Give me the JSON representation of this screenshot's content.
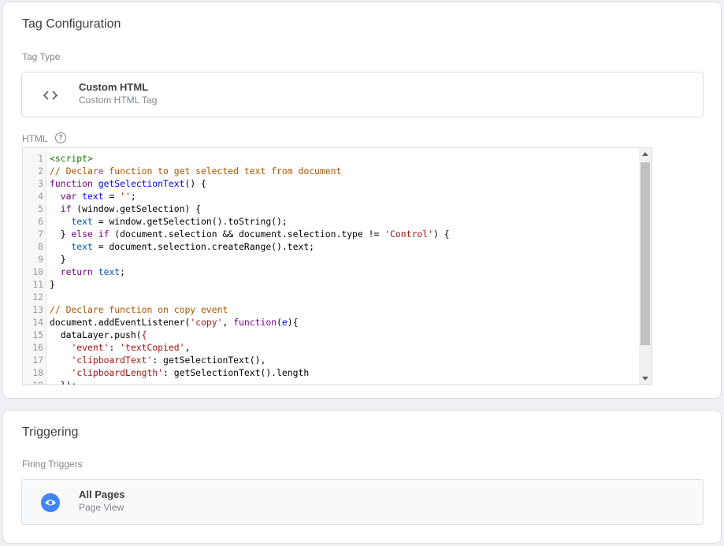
{
  "config": {
    "title": "Tag Configuration",
    "tag_type_label": "Tag Type",
    "tag_type": {
      "name": "Custom HTML",
      "description": "Custom HTML Tag",
      "icon": "code-brackets-icon"
    },
    "html_label": "HTML",
    "help_icon": "help-circle-icon",
    "help_glyph": "?",
    "code_lines": [
      [
        {
          "t": "<script>",
          "c": "tag"
        }
      ],
      [
        {
          "t": "// Declare function to get selected text from document",
          "c": "com"
        }
      ],
      [
        {
          "t": "function ",
          "c": "kw"
        },
        {
          "t": "getSelectionText",
          "c": "def"
        },
        {
          "t": "() {",
          "c": "pl"
        }
      ],
      [
        {
          "t": "  ",
          "c": "pl"
        },
        {
          "t": "var ",
          "c": "kw"
        },
        {
          "t": "text",
          "c": "def"
        },
        {
          "t": " = ",
          "c": "pl"
        },
        {
          "t": "''",
          "c": "str"
        },
        {
          "t": ";",
          "c": "pl"
        }
      ],
      [
        {
          "t": "  ",
          "c": "pl"
        },
        {
          "t": "if",
          "c": "kw"
        },
        {
          "t": " (window.getSelection) {",
          "c": "pl"
        }
      ],
      [
        {
          "t": "    ",
          "c": "pl"
        },
        {
          "t": "text",
          "c": "var"
        },
        {
          "t": " = window.getSelection().toString();",
          "c": "pl"
        }
      ],
      [
        {
          "t": "  } ",
          "c": "pl"
        },
        {
          "t": "else if",
          "c": "kw"
        },
        {
          "t": " (document.selection && document.selection.type != ",
          "c": "pl"
        },
        {
          "t": "'Control'",
          "c": "str"
        },
        {
          "t": ") {",
          "c": "pl"
        }
      ],
      [
        {
          "t": "    ",
          "c": "pl"
        },
        {
          "t": "text",
          "c": "var"
        },
        {
          "t": " = document.selection.createRange().text;",
          "c": "pl"
        }
      ],
      [
        {
          "t": "  }",
          "c": "pl"
        }
      ],
      [
        {
          "t": "  ",
          "c": "pl"
        },
        {
          "t": "return ",
          "c": "kw"
        },
        {
          "t": "text",
          "c": "var"
        },
        {
          "t": ";",
          "c": "pl"
        }
      ],
      [
        {
          "t": "}",
          "c": "pl"
        }
      ],
      [],
      [
        {
          "t": "// Declare function on copy event",
          "c": "com"
        }
      ],
      [
        {
          "t": "document.addEventListener(",
          "c": "pl"
        },
        {
          "t": "'copy'",
          "c": "str"
        },
        {
          "t": ", ",
          "c": "pl"
        },
        {
          "t": "function",
          "c": "kw"
        },
        {
          "t": "(",
          "c": "pl"
        },
        {
          "t": "e",
          "c": "def"
        },
        {
          "t": "){",
          "c": "pl"
        }
      ],
      [
        {
          "t": "  dataLayer.push(",
          "c": "pl"
        },
        {
          "t": "{",
          "c": "br"
        }
      ],
      [
        {
          "t": "    ",
          "c": "pl"
        },
        {
          "t": "'event'",
          "c": "str"
        },
        {
          "t": ": ",
          "c": "pl"
        },
        {
          "t": "'textCopied'",
          "c": "str"
        },
        {
          "t": ",",
          "c": "pl"
        }
      ],
      [
        {
          "t": "    ",
          "c": "pl"
        },
        {
          "t": "'clipboardText'",
          "c": "str"
        },
        {
          "t": ": getSelectionText(),",
          "c": "pl"
        }
      ],
      [
        {
          "t": "    ",
          "c": "pl"
        },
        {
          "t": "'clipboardLength'",
          "c": "str"
        },
        {
          "t": ": getSelectionText().length",
          "c": "pl"
        }
      ],
      [
        {
          "t": "  });",
          "c": "pl"
        }
      ]
    ]
  },
  "triggering": {
    "title": "Triggering",
    "firing_label": "Firing Triggers",
    "trigger": {
      "name": "All Pages",
      "description": "Page View",
      "icon": "eye-icon"
    }
  },
  "colors": {
    "accent": "#4285f4",
    "border": "#dadce0",
    "muted": "#80868b"
  }
}
